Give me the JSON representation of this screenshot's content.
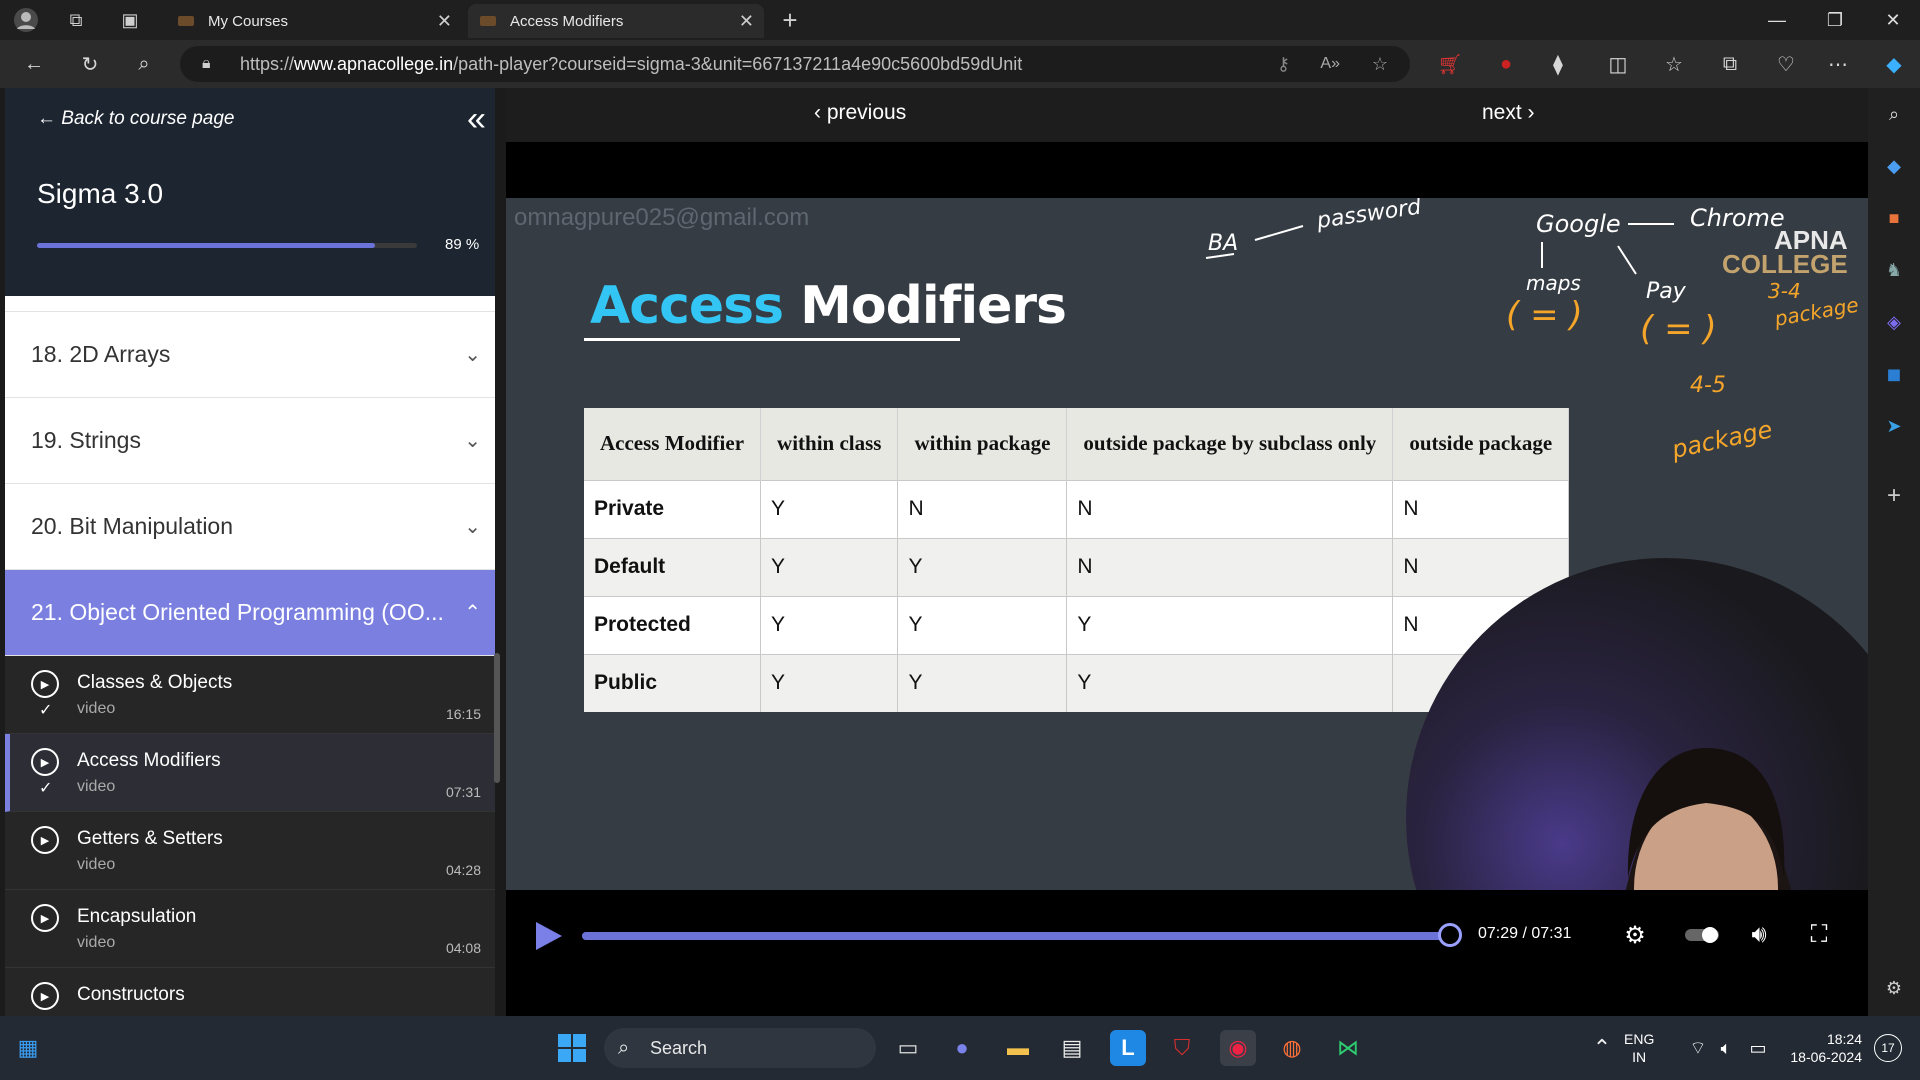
{
  "browser": {
    "tabs": [
      {
        "title": "My Courses"
      },
      {
        "title": "Access Modifiers"
      }
    ],
    "url_prefix": "https://",
    "url_domain": "www.apnacollege.in",
    "url_path": "/path-player?courseid=sigma-3&unit=667137211a4e90c5600bd59dUnit"
  },
  "sidebar": {
    "back_label": "Back to course page",
    "course_title": "Sigma 3.0",
    "progress_fraction": 0.89,
    "progress_pct": "89 %",
    "modules": [
      {
        "label": "18. 2D Arrays"
      },
      {
        "label": "19. Strings"
      },
      {
        "label": "20. Bit Manipulation"
      },
      {
        "label": "21. Object Oriented Programming (OO..."
      }
    ],
    "lessons": [
      {
        "name": "Classes & Objects",
        "type": "video",
        "duration": "16:15",
        "done": true
      },
      {
        "name": "Access Modifiers",
        "type": "video",
        "duration": "07:31",
        "done": true
      },
      {
        "name": "Getters & Setters",
        "type": "video",
        "duration": "04:28",
        "done": false
      },
      {
        "name": "Encapsulation",
        "type": "video",
        "duration": "04:08",
        "done": false
      },
      {
        "name": "Constructors",
        "type": "",
        "duration": "",
        "done": false
      }
    ]
  },
  "player": {
    "previous_label": "previous",
    "next_label": "next",
    "watermark": "omnagpure025@gmail.com",
    "slide_title_1": "Access",
    "slide_title_2": "Modifiers",
    "logo_line1": "APNA",
    "logo_line2": "COLLEGE",
    "table": {
      "headers": [
        "Access Modifier",
        "within class",
        "within package",
        "outside package by subclass only",
        "outside package"
      ],
      "rows": [
        [
          "Private",
          "Y",
          "N",
          "N",
          "N"
        ],
        [
          "Default",
          "Y",
          "Y",
          "N",
          "N"
        ],
        [
          "Protected",
          "Y",
          "Y",
          "Y",
          "N"
        ],
        [
          "Public",
          "Y",
          "Y",
          "Y",
          ""
        ]
      ]
    },
    "annotations": [
      "BA",
      "password",
      "Google",
      "Chrome",
      "maps",
      "Pay",
      "3-4",
      "package",
      "4-5",
      "package"
    ],
    "time": "07:29 / 07:31",
    "played_fraction": 0.9956
  },
  "taskbar": {
    "search_label": "Search",
    "lang_1": "ENG",
    "lang_2": "IN",
    "time": "18:24",
    "date": "18-06-2024",
    "notif_count": "17"
  },
  "colors": {
    "accent": "#6c73d8",
    "title_blue": "#33c6f4",
    "annotation_orange": "#f5a62a"
  }
}
